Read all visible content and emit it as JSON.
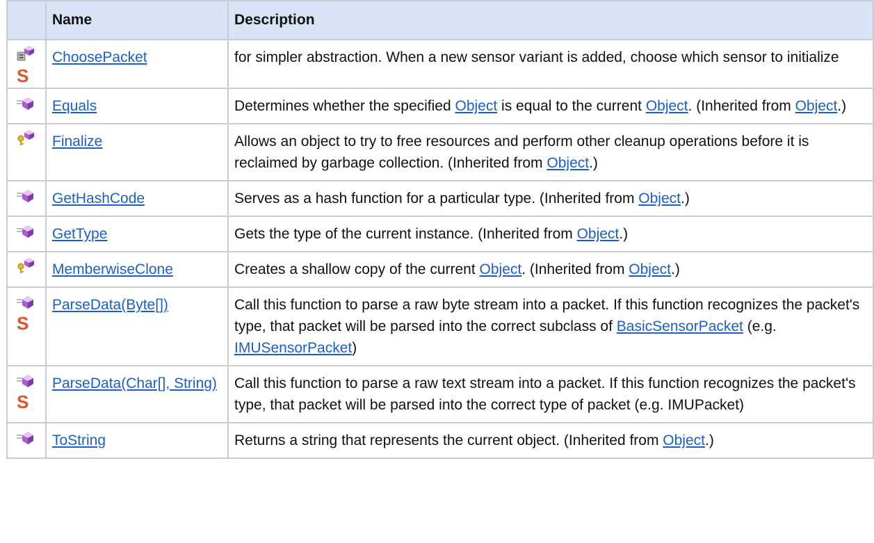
{
  "headers": {
    "name": "Name",
    "description": "Description"
  },
  "rows": [
    {
      "icons": [
        "method-icon",
        "static-icon"
      ],
      "name": "ChoosePacket",
      "desc": [
        {
          "t": "for simpler abstraction. When a new sensor variant is added, choose which sensor to initialize"
        }
      ]
    },
    {
      "icons": [
        "public-method-icon"
      ],
      "name": "Equals",
      "desc": [
        {
          "t": "Determines whether the specified "
        },
        {
          "link": "Object"
        },
        {
          "t": " is equal to the current "
        },
        {
          "link": "Object"
        },
        {
          "t": ". (Inherited from "
        },
        {
          "link": "Object"
        },
        {
          "t": ".)"
        }
      ]
    },
    {
      "icons": [
        "protected-method-icon"
      ],
      "name": "Finalize",
      "desc": [
        {
          "t": "Allows an object to try to free resources and perform other cleanup operations before it is reclaimed by garbage collection. (Inherited from "
        },
        {
          "link": "Object"
        },
        {
          "t": ".)"
        }
      ]
    },
    {
      "icons": [
        "public-method-icon"
      ],
      "name": "GetHashCode",
      "desc": [
        {
          "t": "Serves as a hash function for a particular type. (Inherited from "
        },
        {
          "link": "Object"
        },
        {
          "t": ".)"
        }
      ]
    },
    {
      "icons": [
        "public-method-icon"
      ],
      "name": "GetType",
      "desc": [
        {
          "t": "Gets the type of the current instance. (Inherited from "
        },
        {
          "link": "Object"
        },
        {
          "t": ".)"
        }
      ]
    },
    {
      "icons": [
        "protected-method-icon"
      ],
      "name": "MemberwiseClone",
      "desc": [
        {
          "t": "Creates a shallow copy of the current "
        },
        {
          "link": "Object"
        },
        {
          "t": ". (Inherited from "
        },
        {
          "link": "Object"
        },
        {
          "t": ".)"
        }
      ]
    },
    {
      "icons": [
        "public-method-icon",
        "static-icon"
      ],
      "name": "ParseData(Byte[])",
      "desc": [
        {
          "t": "Call this function to parse a raw byte stream into a packet. If this function recognizes the packet's type, that packet will be parsed into the correct subclass of "
        },
        {
          "link": "BasicSensorPacket"
        },
        {
          "t": " (e.g. "
        },
        {
          "link": "IMUSensorPacket"
        },
        {
          "t": ")"
        }
      ]
    },
    {
      "icons": [
        "public-method-icon",
        "static-icon"
      ],
      "name": "ParseData(Char[], String)",
      "desc": [
        {
          "t": "Call this function to parse a raw text stream into a packet. If this function recognizes the packet's type, that packet will be parsed into the correct type of packet (e.g. IMUPacket)"
        }
      ]
    },
    {
      "icons": [
        "public-method-icon"
      ],
      "name": "ToString",
      "desc": [
        {
          "t": "Returns a string that represents the current object. (Inherited from "
        },
        {
          "link": "Object"
        },
        {
          "t": ".)"
        }
      ]
    }
  ],
  "colors": {
    "header_bg": "#d8e4f6",
    "border": "#c8ccd2",
    "link": "#1a5fc9",
    "static_icon": "#e2522a",
    "method_icon": "#b56cd6"
  }
}
